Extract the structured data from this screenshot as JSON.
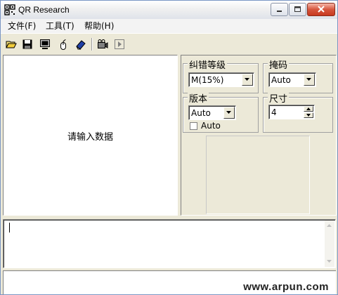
{
  "window": {
    "title": "QR Research"
  },
  "menu": [
    {
      "label": "文件(F)"
    },
    {
      "label": "工具(T)"
    },
    {
      "label": "帮助(H)"
    }
  ],
  "toolbar": {
    "icons": [
      "open-folder-icon",
      "save-disk-icon",
      "monitor-icon",
      "mouse-icon",
      "eraser-icon",
      "camera-icon",
      "play-icon"
    ]
  },
  "left_pane": {
    "prompt": "请输入数据"
  },
  "settings": {
    "ecc": {
      "label": "纠错等级",
      "value": "M(15%)"
    },
    "mask": {
      "label": "掩码",
      "value": "Auto"
    },
    "version": {
      "label": "版本",
      "value": "Auto",
      "checkbox_label": "Auto",
      "checked": false
    },
    "size": {
      "label": "尺寸",
      "value": "4"
    }
  },
  "watermark": "www.arpun.com"
}
